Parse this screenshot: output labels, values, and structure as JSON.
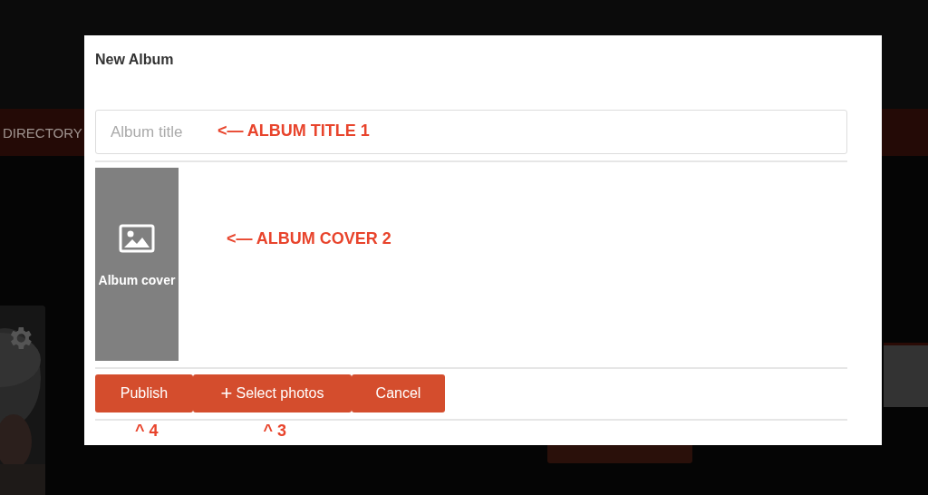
{
  "background": {
    "nav_item": "DIRECTORY"
  },
  "dialog": {
    "title": "New Album",
    "album_title": {
      "placeholder": "Album title",
      "annotation": "<— ALBUM TITLE 1"
    },
    "cover": {
      "label": "Album cover",
      "annotation": "<— ALBUM COVER 2"
    },
    "buttons": [
      {
        "label": "Publish",
        "annotation": "^ 4"
      },
      {
        "icon": "+",
        "label": "Select photos",
        "annotation": "^ 3"
      },
      {
        "label": "Cancel"
      }
    ]
  }
}
